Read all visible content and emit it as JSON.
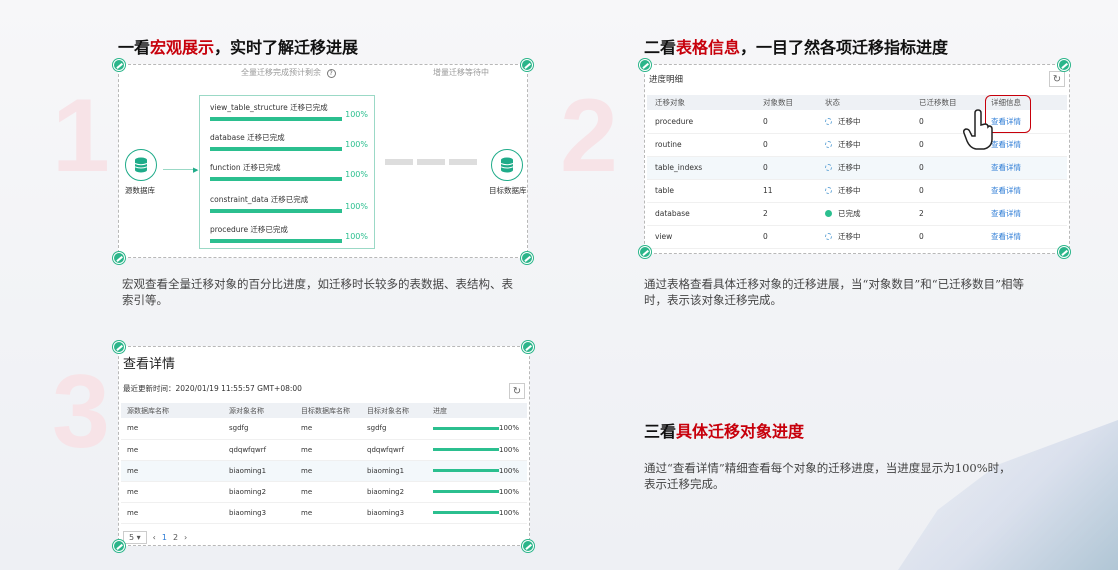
{
  "sections": [
    {
      "number": "1",
      "heading_pre": "一看",
      "heading_hl": "宏观展示",
      "heading_post": "，实时了解迁移进展",
      "desc": "宏观查看全量迁移对象的百分比进度，如迁移时长较多的表数据、表结构、表索引等。"
    },
    {
      "number": "2",
      "heading_pre": "二看",
      "heading_hl": "表格信息",
      "heading_post": "，一目了然各项迁移指标进度",
      "desc": "通过表格查看具体迁移对象的迁移进展，当“对象数目”和“已迁移数目”相等时，表示该对象迁移完成。"
    },
    {
      "number": "3",
      "heading_pre": "三看",
      "heading_hl": "具体迁移对象进度",
      "heading_post": "",
      "desc": "通过“查看详情”精细查看每个对象的迁移进度，当进度显示为100%时，表示迁移完成。"
    }
  ],
  "panel1": {
    "top_left_label": "全量迁移完成预计剩余",
    "top_right_label": "增量迁移等待中",
    "source_label": "源数据库",
    "target_label": "目标数据库",
    "items": [
      {
        "name": "view_table_structure 迁移已完成",
        "pct": "100%",
        "progress": 1.0
      },
      {
        "name": "database 迁移已完成",
        "pct": "100%",
        "progress": 1.0
      },
      {
        "name": "function 迁移已完成",
        "pct": "100%",
        "progress": 1.0
      },
      {
        "name": "constraint_data 迁移已完成",
        "pct": "100%",
        "progress": 1.0
      },
      {
        "name": "procedure 迁移已完成",
        "pct": "100%",
        "progress": 1.0
      }
    ]
  },
  "panel2": {
    "title": "进度明细",
    "refresh_icon": "refresh-icon",
    "columns": [
      "迁移对象",
      "对象数目",
      "状态",
      "已迁移数目",
      "详细信息"
    ],
    "rows": [
      {
        "object": "procedure",
        "count": "0",
        "status": "迁移中",
        "done": false,
        "migrated": "0",
        "detail": "查看详情"
      },
      {
        "object": "routine",
        "count": "0",
        "status": "迁移中",
        "done": false,
        "migrated": "0",
        "detail": "查看详情"
      },
      {
        "object": "table_indexs",
        "count": "0",
        "status": "迁移中",
        "done": false,
        "migrated": "0",
        "detail": "查看详情"
      },
      {
        "object": "table",
        "count": "11",
        "status": "迁移中",
        "done": false,
        "migrated": "0",
        "detail": "查看详情"
      },
      {
        "object": "database",
        "count": "2",
        "status": "已完成",
        "done": true,
        "migrated": "2",
        "detail": "查看详情"
      },
      {
        "object": "view",
        "count": "0",
        "status": "迁移中",
        "done": false,
        "migrated": "0",
        "detail": "查看详情"
      }
    ]
  },
  "panel3": {
    "title": "查看详情",
    "updated": "最近更新时间：2020/01/19 11:55:57 GMT+08:00",
    "columns": [
      "源数据库名称",
      "源对象名称",
      "目标数据库名称",
      "目标对象名称",
      "进度"
    ],
    "rows": [
      {
        "src_db": "me",
        "src_obj": "sgdfg",
        "dst_db": "me",
        "dst_obj": "sgdfg",
        "pct": "100%",
        "progress": 1.0
      },
      {
        "src_db": "me",
        "src_obj": "qdqwfqwrf",
        "dst_db": "me",
        "dst_obj": "qdqwfqwrf",
        "pct": "100%",
        "progress": 1.0
      },
      {
        "src_db": "me",
        "src_obj": "biaoming1",
        "dst_db": "me",
        "dst_obj": "biaoming1",
        "pct": "100%",
        "progress": 1.0
      },
      {
        "src_db": "me",
        "src_obj": "biaoming2",
        "dst_db": "me",
        "dst_obj": "biaoming2",
        "pct": "100%",
        "progress": 1.0
      },
      {
        "src_db": "me",
        "src_obj": "biaoming3",
        "dst_db": "me",
        "dst_obj": "biaoming3",
        "pct": "100%",
        "progress": 1.0
      }
    ],
    "pager": {
      "page_size": "5",
      "pages": [
        "1",
        "2"
      ],
      "current": "1"
    }
  },
  "colors": {
    "accent": "#c7000b",
    "progress": "#2bbf8f",
    "link": "#2d7cd6",
    "handle": "#2bb58a"
  }
}
